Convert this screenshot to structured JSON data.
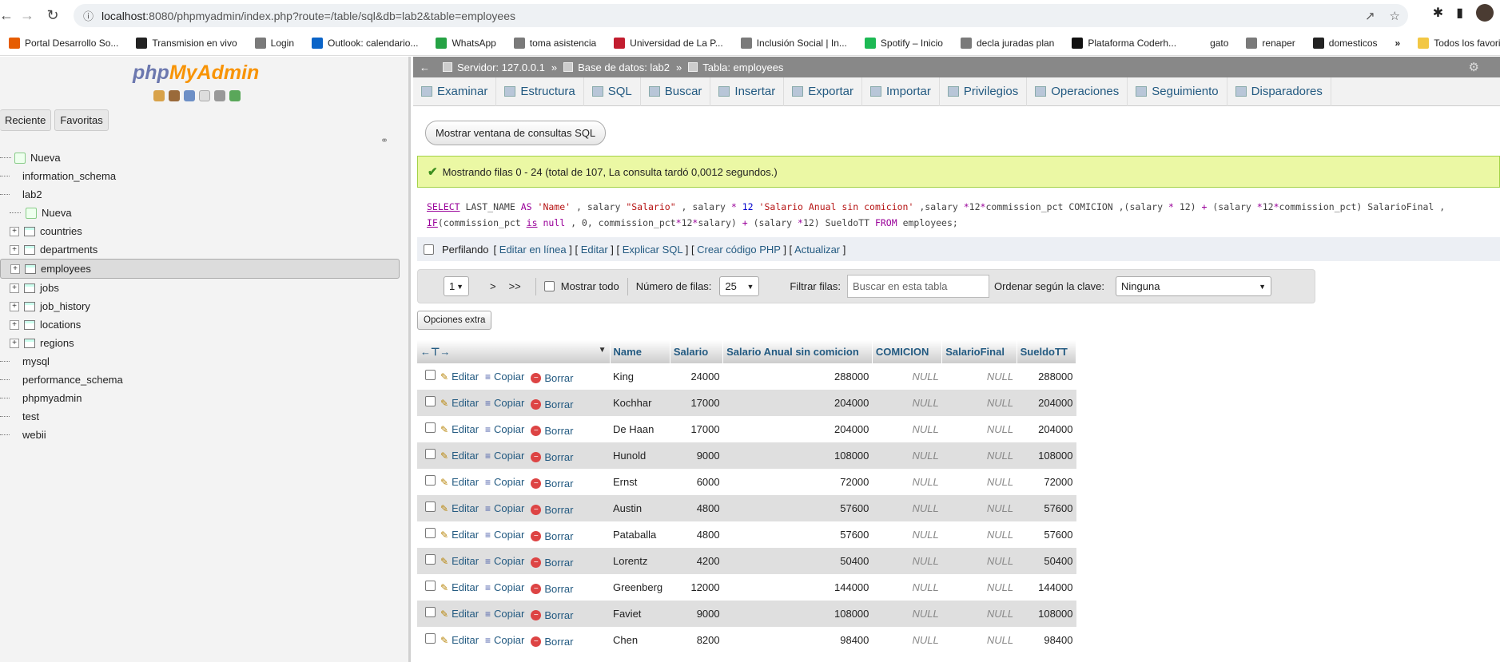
{
  "browser": {
    "url_host": "localhost",
    "url_rest": ":8080/phpmyadmin/index.php?route=/table/sql&db=lab2&table=employees",
    "bookmarks": [
      {
        "label": "Portal Desarrollo So...",
        "color": "#e65c00"
      },
      {
        "label": "Transmision en vivo",
        "color": "#222222"
      },
      {
        "label": "Login",
        "color": "#7a7a7a"
      },
      {
        "label": "Outlook: calendario...",
        "color": "#0a64c8"
      },
      {
        "label": "WhatsApp",
        "color": "#25a244"
      },
      {
        "label": "toma asistencia",
        "color": "#7a7a7a"
      },
      {
        "label": "Universidad de La P...",
        "color": "#c21d2f"
      },
      {
        "label": "Inclusión Social | In...",
        "color": "#7a7a7a"
      },
      {
        "label": "Spotify – Inicio",
        "color": "#1db954"
      },
      {
        "label": "decla juradas plan",
        "color": "#7a7a7a"
      },
      {
        "label": "Plataforma Coderh...",
        "color": "#111111"
      },
      {
        "label": "gato",
        "color": "#ffffff"
      },
      {
        "label": "renaper",
        "color": "#7a7a7a"
      },
      {
        "label": "domesticos",
        "color": "#222222"
      }
    ],
    "more_bookmarks": "»",
    "all_favorites": "Todos los favoritos"
  },
  "nav": {
    "logo_php": "php",
    "logo_my": "MyAdmin",
    "tabs": [
      "Reciente",
      "Favoritas"
    ],
    "tree": [
      {
        "label": "Nueva",
        "type": "new",
        "level": 1
      },
      {
        "label": "information_schema",
        "type": "db",
        "level": 1
      },
      {
        "label": "lab2",
        "type": "db-open",
        "level": 1
      },
      {
        "label": "Nueva",
        "type": "new",
        "level": 2
      },
      {
        "label": "countries",
        "type": "table",
        "level": 2
      },
      {
        "label": "departments",
        "type": "table",
        "level": 2
      },
      {
        "label": "employees",
        "type": "table",
        "level": 2,
        "selected": true
      },
      {
        "label": "jobs",
        "type": "table",
        "level": 2
      },
      {
        "label": "job_history",
        "type": "table",
        "level": 2
      },
      {
        "label": "locations",
        "type": "table",
        "level": 2
      },
      {
        "label": "regions",
        "type": "table",
        "level": 2
      },
      {
        "label": "mysql",
        "type": "db",
        "level": 1
      },
      {
        "label": "performance_schema",
        "type": "db",
        "level": 1
      },
      {
        "label": "phpmyadmin",
        "type": "db",
        "level": 1
      },
      {
        "label": "test",
        "type": "db",
        "level": 1
      },
      {
        "label": "webii",
        "type": "db",
        "level": 1
      }
    ]
  },
  "breadcrumb": {
    "server": "Servidor: 127.0.0.1",
    "database": "Base de datos: lab2",
    "table": "Tabla: employees"
  },
  "tabs": [
    "Examinar",
    "Estructura",
    "SQL",
    "Buscar",
    "Insertar",
    "Exportar",
    "Importar",
    "Privilegios",
    "Operaciones",
    "Seguimiento",
    "Disparadores"
  ],
  "sql_window_button": "Mostrar ventana de consultas SQL",
  "success_message": "Mostrando filas 0 - 24 (total de 107, La consulta tardó 0,0012 segundos.)",
  "sql_query": {
    "line1": "SELECT LAST_NAME AS 'Name' , salary \"Salario\" , salary * 12 'Salario Anual sin comicion' ,salary *12*commission_pct COMICION ,(salary * 12) + (salary *12*commission_pct) SalarioFinal ,",
    "line2": "IF(commission_pct is null , 0, commission_pct*12*salary) + (salary *12) SueldoTT FROM employees;"
  },
  "profiling": {
    "label": "Perfilando",
    "links": [
      "Editar en línea",
      "Editar",
      "Explicar SQL",
      "Crear código PHP",
      "Actualizar"
    ]
  },
  "pagination": {
    "page": "1",
    "next": ">",
    "last": ">>",
    "show_all": "Mostrar todo",
    "rows_label": "Número de filas:",
    "rows_value": "25",
    "filter_label": "Filtrar filas:",
    "filter_placeholder": "Buscar en esta tabla",
    "sort_label": "Ordenar según la clave:",
    "sort_value": "Ninguna"
  },
  "extra_options": "Opciones extra",
  "table": {
    "headers": [
      "Name",
      "Salario",
      "Salario Anual sin comicion",
      "COMICION",
      "SalarioFinal",
      "SueldoTT"
    ],
    "actions": {
      "edit": "Editar",
      "copy": "Copiar",
      "delete": "Borrar"
    },
    "rows": [
      [
        "King",
        "24000",
        "288000",
        "NULL",
        "NULL",
        "288000"
      ],
      [
        "Kochhar",
        "17000",
        "204000",
        "NULL",
        "NULL",
        "204000"
      ],
      [
        "De Haan",
        "17000",
        "204000",
        "NULL",
        "NULL",
        "204000"
      ],
      [
        "Hunold",
        "9000",
        "108000",
        "NULL",
        "NULL",
        "108000"
      ],
      [
        "Ernst",
        "6000",
        "72000",
        "NULL",
        "NULL",
        "72000"
      ],
      [
        "Austin",
        "4800",
        "57600",
        "NULL",
        "NULL",
        "57600"
      ],
      [
        "Pataballa",
        "4800",
        "57600",
        "NULL",
        "NULL",
        "57600"
      ],
      [
        "Lorentz",
        "4200",
        "50400",
        "NULL",
        "NULL",
        "50400"
      ],
      [
        "Greenberg",
        "12000",
        "144000",
        "NULL",
        "NULL",
        "144000"
      ],
      [
        "Faviet",
        "9000",
        "108000",
        "NULL",
        "NULL",
        "108000"
      ],
      [
        "Chen",
        "8200",
        "98400",
        "NULL",
        "NULL",
        "98400"
      ]
    ]
  }
}
